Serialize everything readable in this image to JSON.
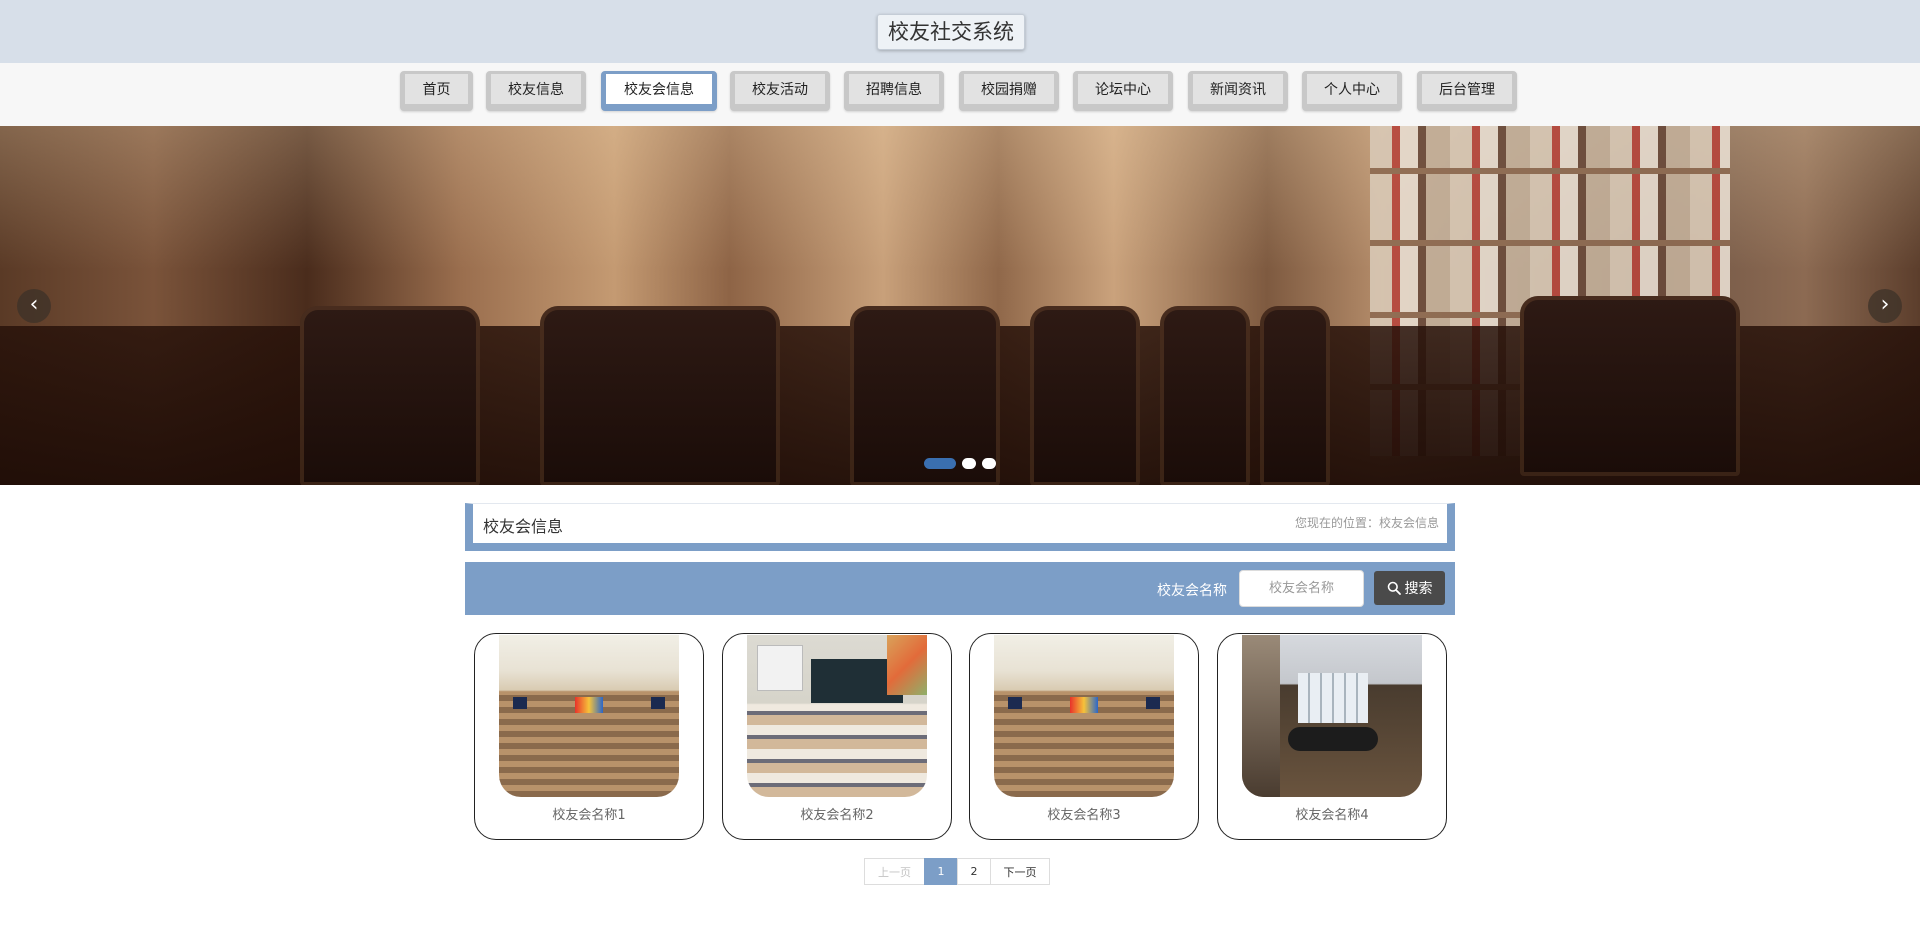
{
  "header": {
    "title": "校友社交系统"
  },
  "nav": {
    "items": [
      {
        "label": "首页"
      },
      {
        "label": "校友信息"
      },
      {
        "label": "校友会信息",
        "active": true
      },
      {
        "label": "校友活动"
      },
      {
        "label": "招聘信息"
      },
      {
        "label": "校园捐赠"
      },
      {
        "label": "论坛中心"
      },
      {
        "label": "新闻资讯"
      },
      {
        "label": "个人中心"
      },
      {
        "label": "后台管理"
      }
    ]
  },
  "banner": {
    "prev_icon": "chevron-left-icon",
    "next_icon": "chevron-right-icon",
    "slide_count": 3,
    "active_slide": 1
  },
  "section": {
    "title": "校友会信息",
    "location": "您现在的位置：校友会信息"
  },
  "search": {
    "label": "校友会名称",
    "placeholder": "校友会名称",
    "button_label": "搜索",
    "button_icon": "search-icon"
  },
  "cards": [
    {
      "name": "校友会名称1",
      "image": "auditorium"
    },
    {
      "name": "校友会名称2",
      "image": "classroom"
    },
    {
      "name": "校友会名称3",
      "image": "auditorium"
    },
    {
      "name": "校友会名称4",
      "image": "meeting-room"
    }
  ],
  "pagination": {
    "prev": "上一页",
    "pages": [
      "1",
      "2"
    ],
    "current": "1",
    "next": "下一页"
  },
  "colors": {
    "accent": "#7c9ec7",
    "header_bg": "#d7dfe9",
    "nav_bg": "#f7f7f7",
    "search_button": "#4a4a4a"
  }
}
